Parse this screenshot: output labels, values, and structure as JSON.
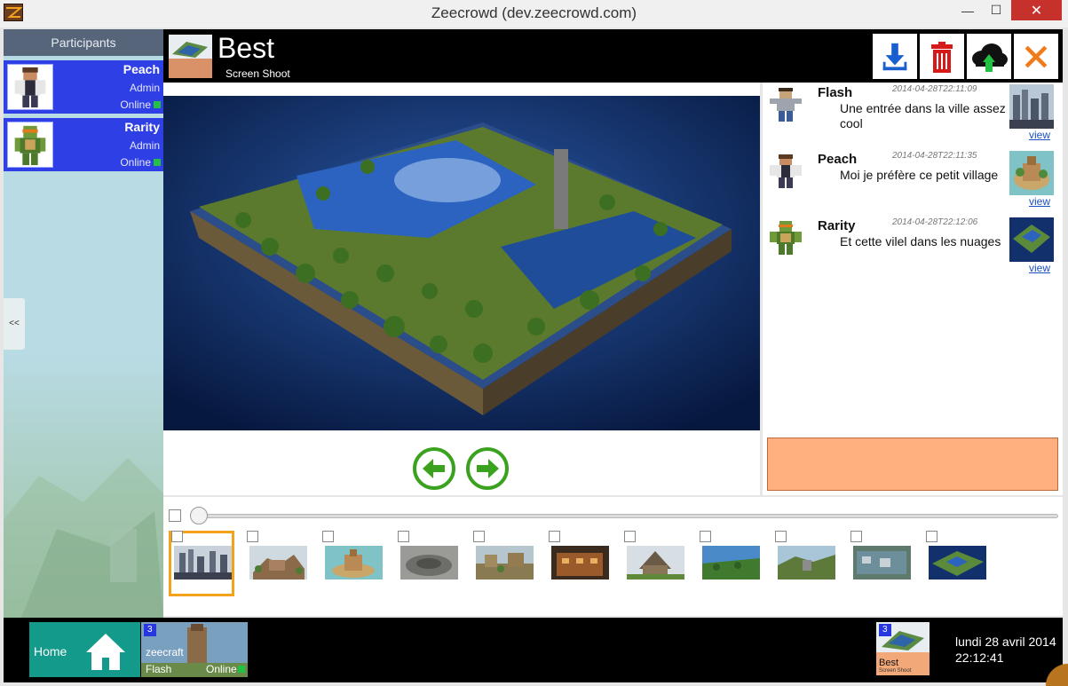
{
  "window": {
    "title": "Zeecrowd (dev.zeecrowd.com)",
    "minimize": "—",
    "maximize": "☐",
    "close": "✕"
  },
  "sidebar": {
    "header": "Participants",
    "collapse_label": "<<",
    "participants": [
      {
        "name": "Peach",
        "role": "Admin",
        "status": "Online"
      },
      {
        "name": "Rarity",
        "role": "Admin",
        "status": "Online"
      }
    ]
  },
  "document": {
    "title": "Best",
    "subtitle": "Screen Shoot"
  },
  "toolbar": {
    "download": "download-icon",
    "delete": "trash-icon",
    "upload": "cloud-upload-icon",
    "close": "close-icon"
  },
  "comments": [
    {
      "author": "Flash",
      "date": "2014-04-28T22:11:09",
      "text": "Une entrée dans la ville assez cool",
      "link": "view"
    },
    {
      "author": "Peach",
      "date": "2014-04-28T22:11:35",
      "text": "Moi je préfère ce petit village",
      "link": "view"
    },
    {
      "author": "Rarity",
      "date": "2014-04-28T22:12:06",
      "text": "Et cette vilel dans les nuages",
      "link": "view"
    }
  ],
  "gallery": {
    "count": 11,
    "selected_index": 0,
    "slider_position": 0
  },
  "taskbar": {
    "home_label": "Home",
    "room": {
      "badge": "3",
      "name": "zeecraft",
      "user": "Flash",
      "status": "Online"
    },
    "doc_tile": {
      "badge": "3",
      "title": "Best",
      "subtitle": "Screen Shoot"
    },
    "date": "lundi 28 avril 2014",
    "time": "22:12:41"
  },
  "colors": {
    "accent_blue": "#2f3fe6",
    "online_green": "#22c043",
    "home_teal": "#139a8a",
    "comment_input": "#ffb07e",
    "selection": "#f3a21b"
  }
}
